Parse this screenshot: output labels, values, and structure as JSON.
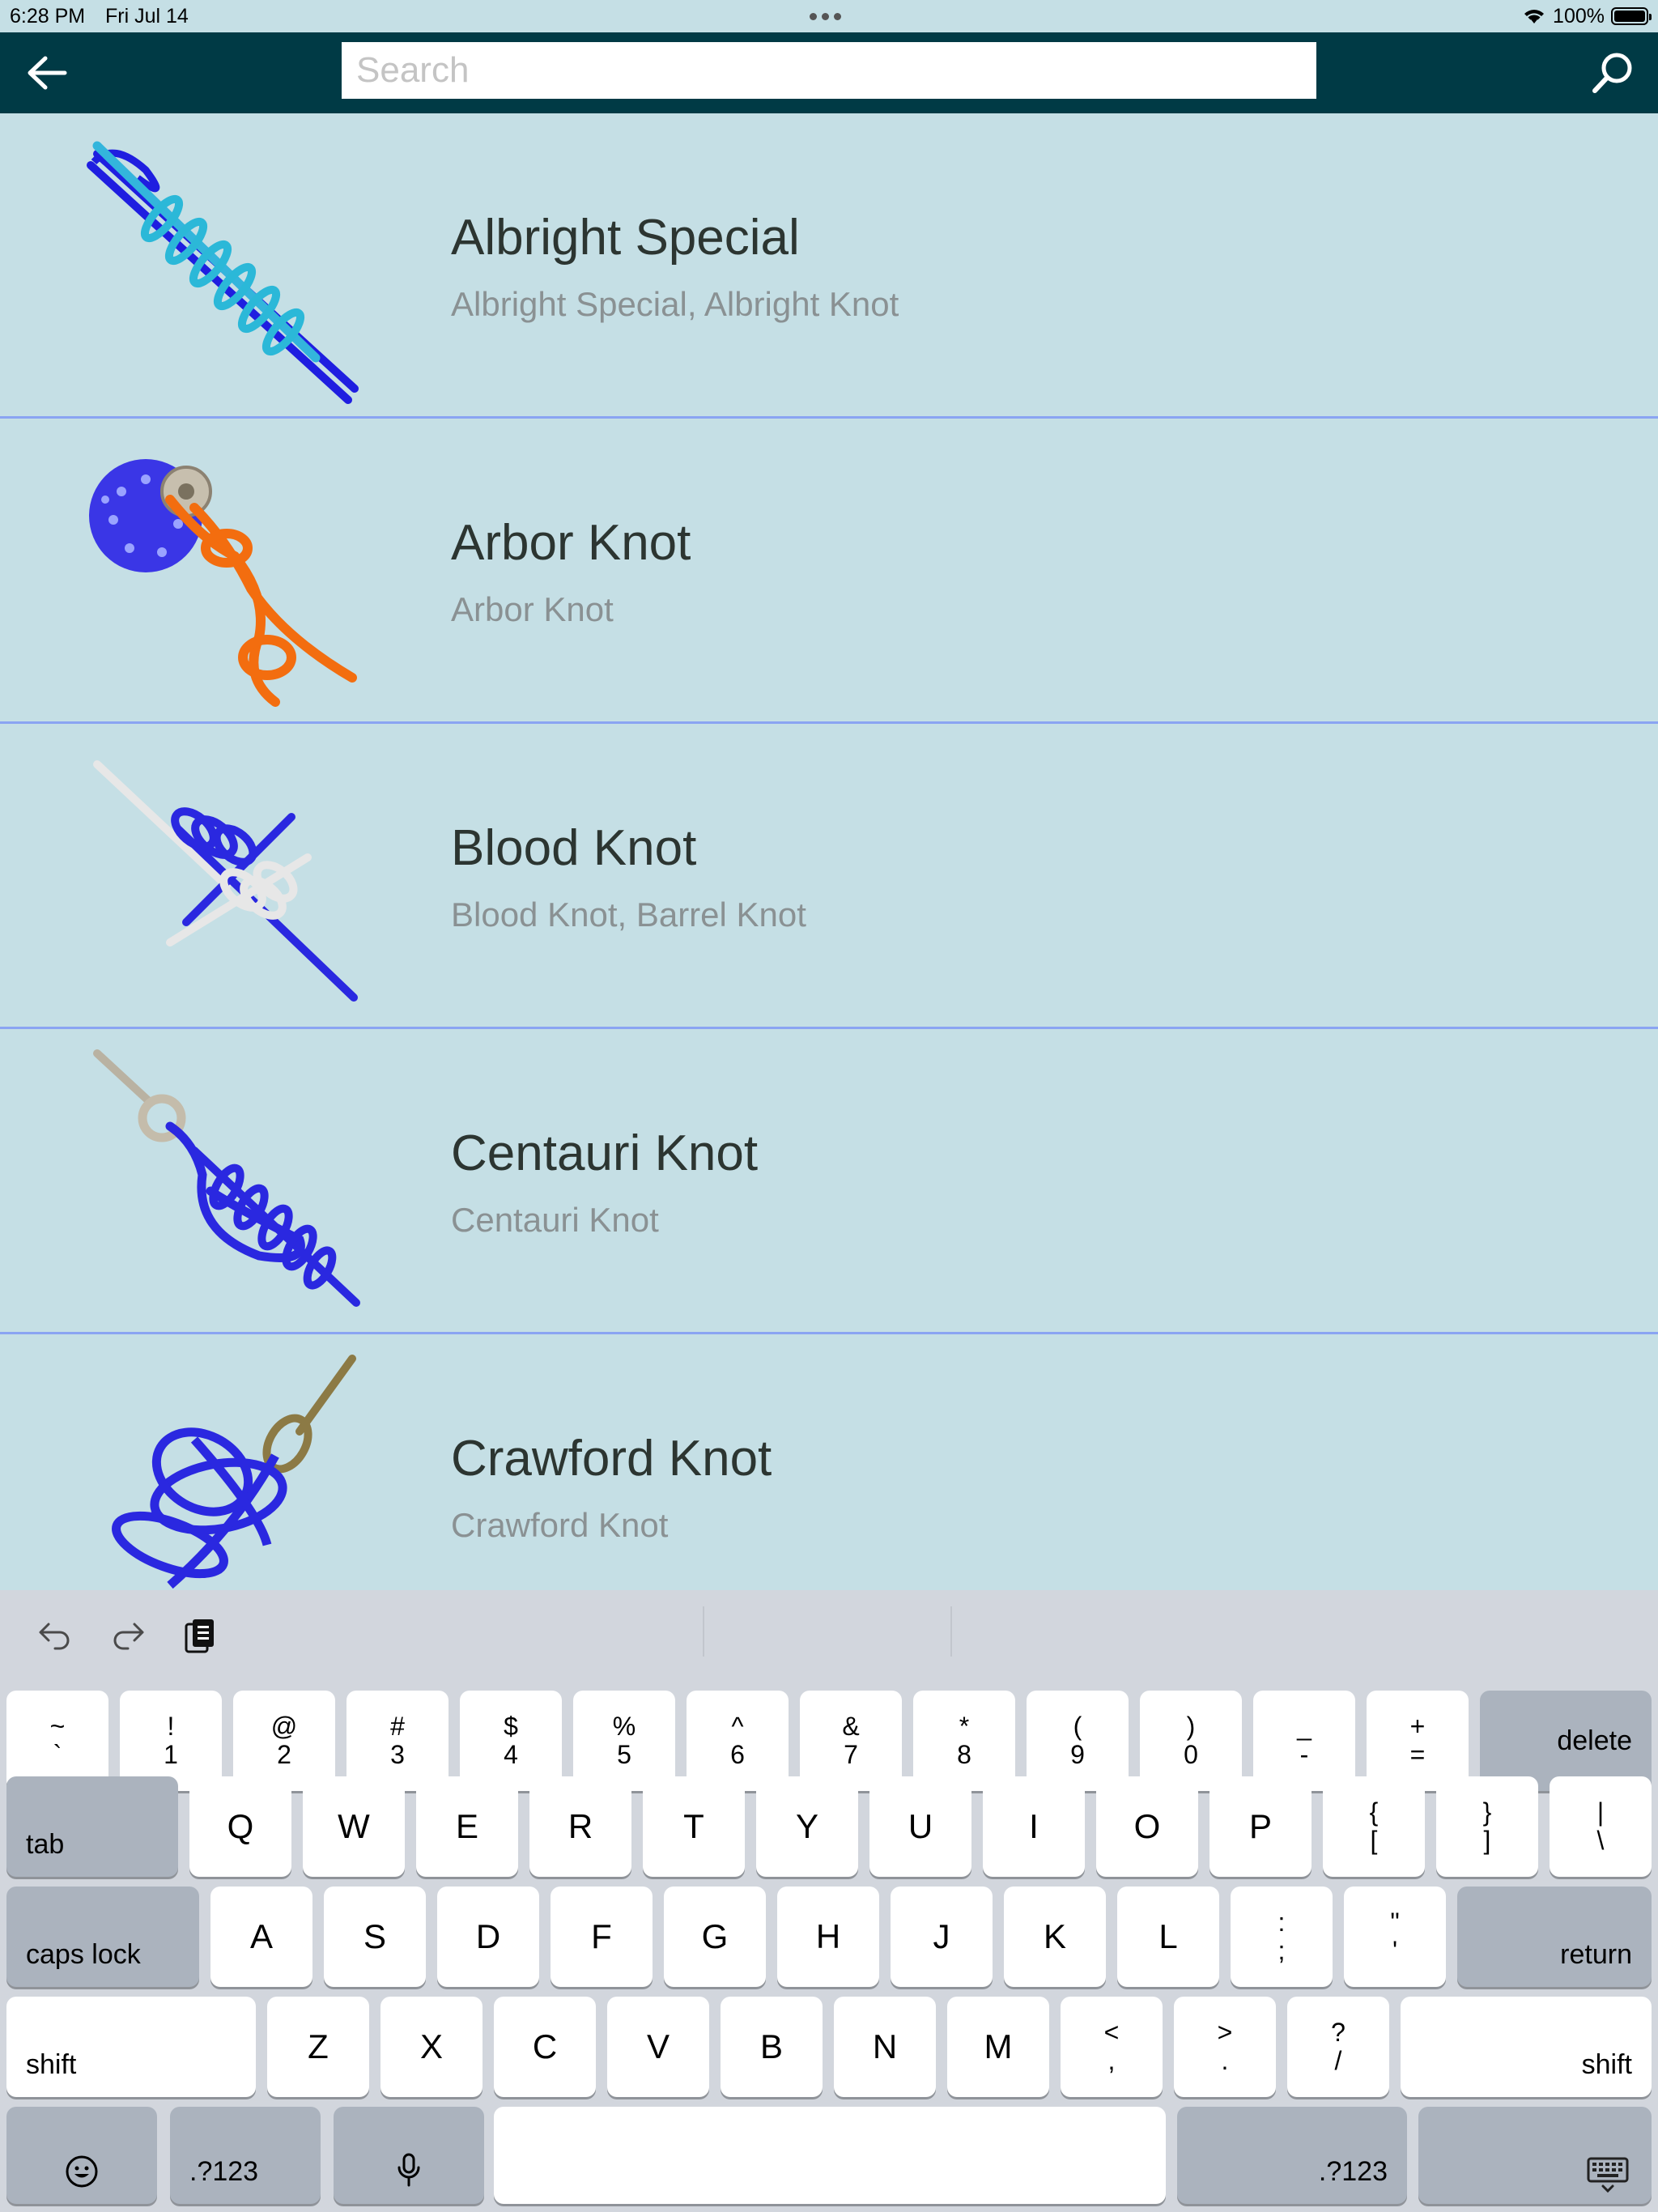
{
  "status_bar": {
    "time": "6:28 PM",
    "date": "Fri Jul 14",
    "battery": "100%",
    "battery_level": 1.0,
    "icons": [
      "wifi-icon",
      "battery-icon",
      "multitasking-dots-icon"
    ]
  },
  "nav": {
    "back_icon": "arrow-left-icon",
    "search_placeholder": "Search",
    "search_value": "",
    "search_icon": "magnifier-icon"
  },
  "colors": {
    "nav_background": "#003a45",
    "list_background": "#c5dfe5",
    "row_divider": "#8aa4f2",
    "title_text": "#2c3531",
    "subtitle_text": "#8a9193"
  },
  "knots": [
    {
      "title": "Albright Special",
      "aliases": "Albright Special, Albright Knot",
      "thumb_icon": "albright-knot-illustration"
    },
    {
      "title": "Arbor Knot",
      "aliases": "Arbor Knot",
      "thumb_icon": "arbor-knot-illustration"
    },
    {
      "title": "Blood Knot",
      "aliases": "Blood Knot, Barrel Knot",
      "thumb_icon": "blood-knot-illustration"
    },
    {
      "title": "Centauri Knot",
      "aliases": "Centauri Knot",
      "thumb_icon": "centauri-knot-illustration"
    },
    {
      "title": "Crawford Knot",
      "aliases": "Crawford Knot",
      "thumb_icon": "crawford-knot-illustration"
    }
  ],
  "keyboard": {
    "toolbar": {
      "undo_icon": "undo-icon",
      "redo_icon": "redo-icon",
      "paste_icon": "clipboard-icon"
    },
    "number_row": [
      {
        "top": "~",
        "bottom": "`"
      },
      {
        "top": "!",
        "bottom": "1"
      },
      {
        "top": "@",
        "bottom": "2"
      },
      {
        "top": "#",
        "bottom": "3"
      },
      {
        "top": "$",
        "bottom": "4"
      },
      {
        "top": "%",
        "bottom": "5"
      },
      {
        "top": "^",
        "bottom": "6"
      },
      {
        "top": "&",
        "bottom": "7"
      },
      {
        "top": "*",
        "bottom": "8"
      },
      {
        "top": "(",
        "bottom": "9"
      },
      {
        "top": ")",
        "bottom": "0"
      },
      {
        "top": "_",
        "bottom": "-"
      },
      {
        "top": "+",
        "bottom": "="
      }
    ],
    "delete": "delete",
    "tab": "tab",
    "row_q": [
      "Q",
      "W",
      "E",
      "R",
      "T",
      "Y",
      "U",
      "I",
      "O",
      "P"
    ],
    "row_q_symbols": [
      {
        "top": "{",
        "bottom": "["
      },
      {
        "top": "}",
        "bottom": "]"
      },
      {
        "top": "|",
        "bottom": "\\"
      }
    ],
    "caps_lock": "caps lock",
    "row_a": [
      "A",
      "S",
      "D",
      "F",
      "G",
      "H",
      "J",
      "K",
      "L"
    ],
    "row_a_symbols": [
      {
        "top": ":",
        "bottom": ";"
      },
      {
        "top": "\"",
        "bottom": "'"
      }
    ],
    "return": "return",
    "shift": "shift",
    "row_z": [
      "Z",
      "X",
      "C",
      "V",
      "B",
      "N",
      "M"
    ],
    "row_z_symbols": [
      {
        "top": "<",
        "bottom": ","
      },
      {
        "top": ">",
        "bottom": "."
      },
      {
        "top": "?",
        "bottom": "/"
      }
    ],
    "emoji_icon": "emoji-icon",
    "numbers_key": ".?123",
    "mic_icon": "microphone-icon",
    "hide_keyboard_icon": "keyboard-dismiss-icon"
  }
}
